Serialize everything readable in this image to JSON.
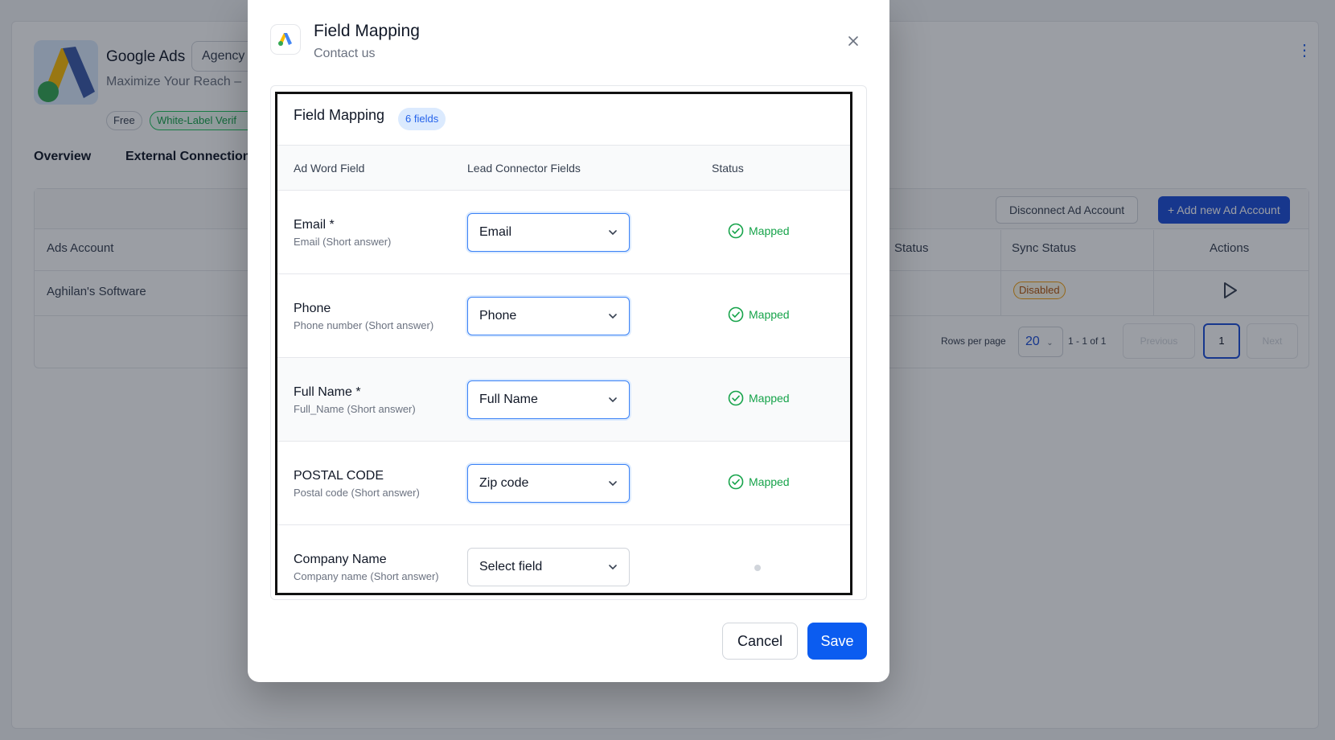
{
  "background": {
    "app_title": "Google Ads",
    "agency_chip": "Agency",
    "subtitle": "Maximize Your Reach – ",
    "badges": {
      "free": "Free",
      "white_label": "White-Label Verif"
    },
    "tabs": [
      "Overview",
      "External Connection"
    ],
    "buttons": {
      "disconnect": "Disconnect Ad Account",
      "add": "+ Add new Ad Account"
    },
    "table": {
      "headers": {
        "ads_account": "Ads Account",
        "status": "Status",
        "sync_status": "Sync Status",
        "actions": "Actions"
      },
      "row": {
        "ads_account": "Aghilan's Software",
        "sync_status": "Disabled"
      }
    },
    "pagination": {
      "rows_per_page_label": "Rows per page",
      "rows_per_page": "20",
      "range": "1 - 1 of 1",
      "previous": "Previous",
      "current_page": "1",
      "next": "Next"
    }
  },
  "modal": {
    "title": "Field Mapping",
    "subtitle": "Contact us",
    "section_title": "Field Mapping",
    "fields_badge": "6 fields",
    "columns": {
      "ad_word_field": "Ad Word Field",
      "lead_connector_fields": "Lead Connector Fields",
      "status": "Status"
    },
    "rows": [
      {
        "name": "Email *",
        "desc": "Email (Short answer)",
        "selected": "Email",
        "status": "Mapped"
      },
      {
        "name": "Phone",
        "desc": "Phone number (Short answer)",
        "selected": "Phone",
        "status": "Mapped"
      },
      {
        "name": "Full Name *",
        "desc": "Full_Name (Short answer)",
        "selected": "Full Name",
        "status": "Mapped"
      },
      {
        "name": "POSTAL CODE",
        "desc": "Postal code (Short answer)",
        "selected": "Zip code",
        "status": "Mapped"
      },
      {
        "name": "Company Name",
        "desc": "Company name (Short answer)",
        "selected": "Select field",
        "status": ""
      }
    ],
    "buttons": {
      "cancel": "Cancel",
      "save": "Save"
    }
  },
  "colors": {
    "primary": "#0b5cf0",
    "mapped": "#16a34a",
    "badge_bg": "#dbeafe"
  }
}
